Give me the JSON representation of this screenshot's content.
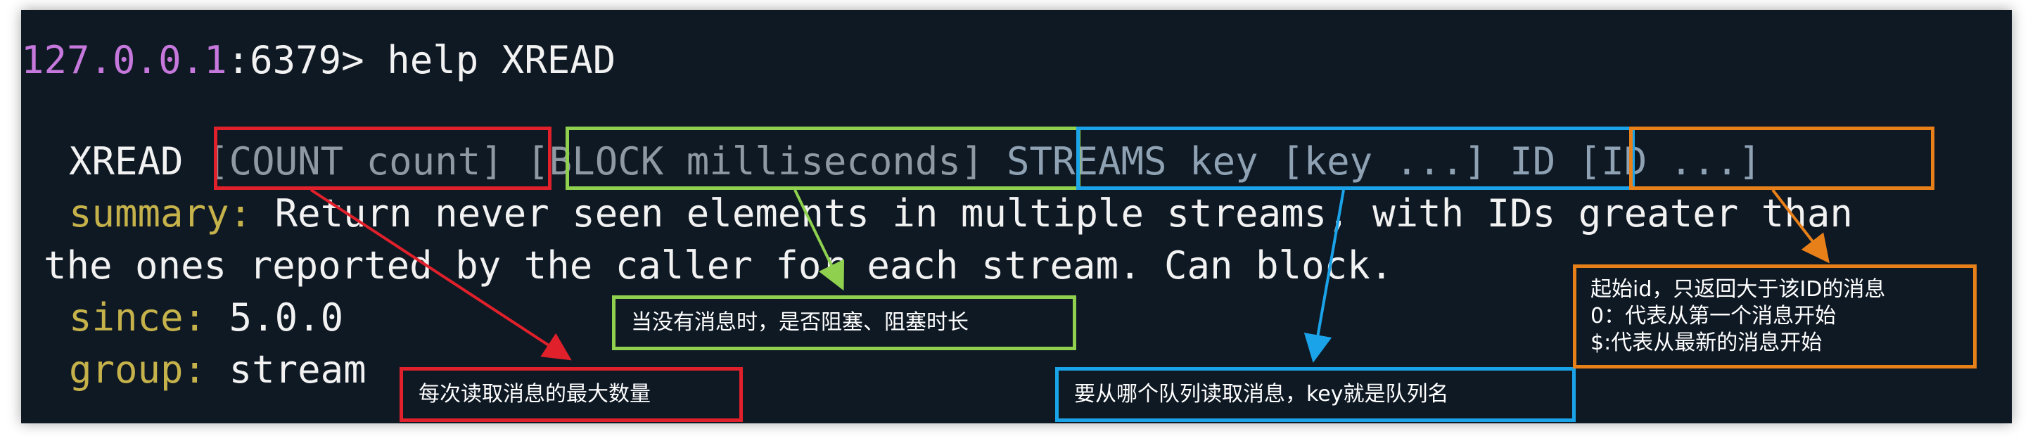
{
  "prompt": {
    "host": "127.0.0.1",
    "port": ":6379",
    "symbol": "> ",
    "command": "help XREAD"
  },
  "usage": {
    "command": "XREAD",
    "count_arg": "[COUNT count]",
    "block_arg": "[BLOCK milliseconds]",
    "streams_arg": "STREAMS key [key ...]",
    "id_arg": "ID [ID ...]"
  },
  "summary": {
    "key": "summary:",
    "text_line1": " Return never seen elements in multiple streams, with IDs greater than",
    "text_line2": "the ones reported by the caller for each stream. Can block."
  },
  "since": {
    "key": "since:",
    "value": " 5.0.0"
  },
  "group": {
    "key": "group:",
    "value": " stream"
  },
  "annotations": {
    "count": "每次读取消息的最大数量",
    "block": "当没有消息时，是否阻塞、阻塞时长",
    "streams": "要从哪个队列读取消息，key就是队列名",
    "id_line1": "起始id，只返回大于该ID的消息",
    "id_line2": "0：代表从第一个消息开始",
    "id_line3": "$:代表从最新的消息开始"
  },
  "colors": {
    "terminal_bg": "#0f1924",
    "red": "#e0202a",
    "green": "#8fd14f",
    "blue": "#1aa3e8",
    "orange": "#e8801a",
    "host_purple": "#c678dd",
    "key_yellow": "#c6b24a"
  }
}
